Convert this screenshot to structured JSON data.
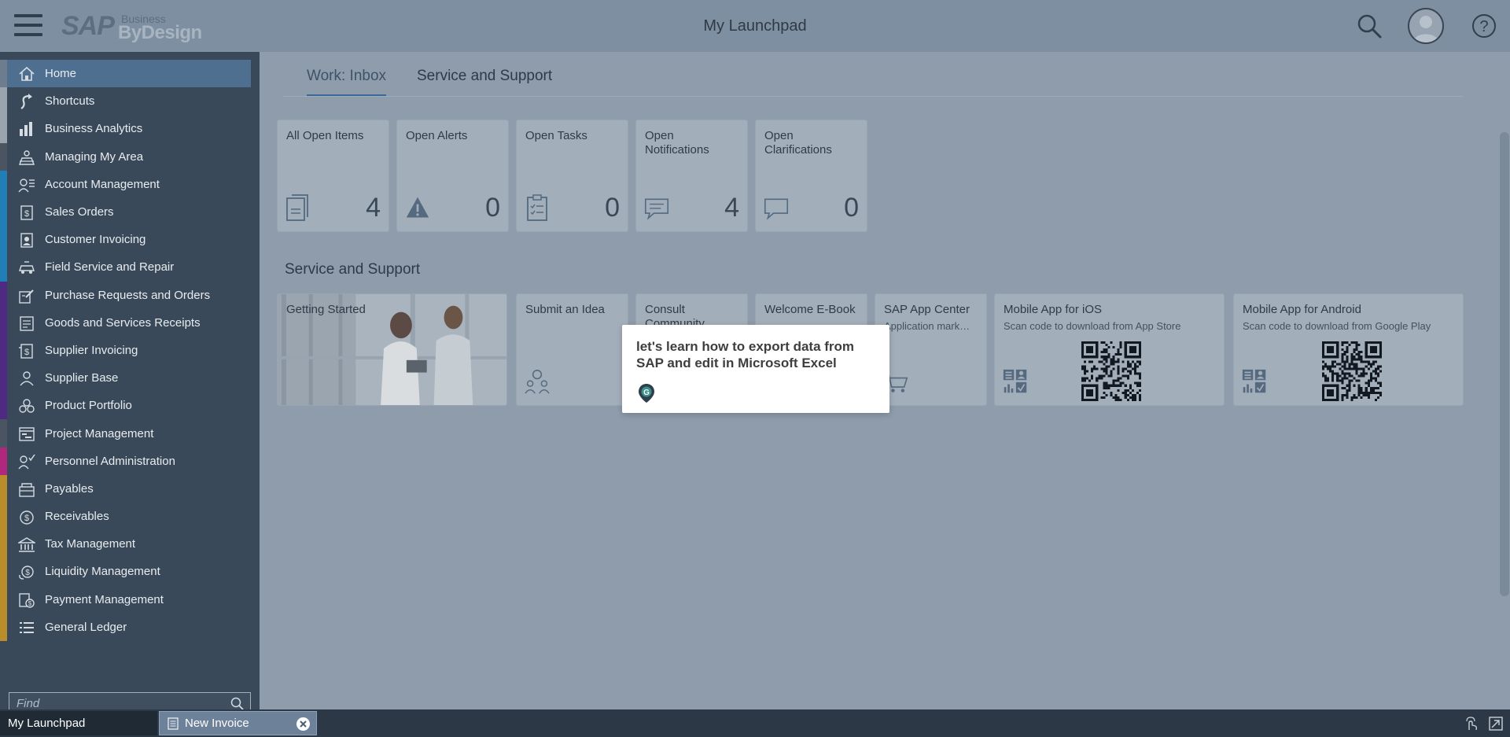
{
  "header": {
    "logo_sap": "SAP",
    "logo_business": "Business",
    "logo_bydesign": "ByDesign",
    "title": "My Launchpad"
  },
  "sidebar": {
    "items": [
      {
        "label": "Home",
        "icon": "home-icon",
        "color": "#6d7d8e"
      },
      {
        "label": "Shortcuts",
        "icon": "shortcut-icon",
        "color": "#9aa4ae"
      },
      {
        "label": "Business Analytics",
        "icon": "analytics-icon",
        "color": "#9aa4ae"
      },
      {
        "label": "Managing My Area",
        "icon": "managing-area-icon",
        "color": "#4b5562"
      },
      {
        "label": "Account Management",
        "icon": "account-management-icon",
        "color": "#1f7fb6"
      },
      {
        "label": "Sales Orders",
        "icon": "sales-orders-icon",
        "color": "#1f7fb6"
      },
      {
        "label": "Customer Invoicing",
        "icon": "customer-invoicing-icon",
        "color": "#1f7fb6"
      },
      {
        "label": "Field Service and Repair",
        "icon": "field-service-icon",
        "color": "#1f7fb6"
      },
      {
        "label": "Purchase Requests and Orders",
        "icon": "purchase-icon",
        "color": "#4e2a82"
      },
      {
        "label": "Goods and Services Receipts",
        "icon": "goods-receipts-icon",
        "color": "#4e2a82"
      },
      {
        "label": "Supplier Invoicing",
        "icon": "supplier-invoicing-icon",
        "color": "#4e2a82"
      },
      {
        "label": "Supplier Base",
        "icon": "supplier-base-icon",
        "color": "#4e2a82"
      },
      {
        "label": "Product Portfolio",
        "icon": "product-portfolio-icon",
        "color": "#4e2a82"
      },
      {
        "label": "Project Management",
        "icon": "project-management-icon",
        "color": "#4b5562"
      },
      {
        "label": "Personnel Administration",
        "icon": "personnel-icon",
        "color": "#b0277e"
      },
      {
        "label": "Payables",
        "icon": "payables-icon",
        "color": "#b88d2a"
      },
      {
        "label": "Receivables",
        "icon": "receivables-icon",
        "color": "#b88d2a"
      },
      {
        "label": "Tax Management",
        "icon": "tax-icon",
        "color": "#b88d2a"
      },
      {
        "label": "Liquidity Management",
        "icon": "liquidity-icon",
        "color": "#b88d2a"
      },
      {
        "label": "Payment Management",
        "icon": "payment-icon",
        "color": "#b88d2a"
      },
      {
        "label": "General Ledger",
        "icon": "ledger-icon",
        "color": "#b88d2a"
      }
    ],
    "find_placeholder": "Find"
  },
  "tabs": [
    {
      "label": "Work: Inbox"
    },
    {
      "label": "Service and Support"
    }
  ],
  "work_tiles": [
    {
      "title": "All Open Items",
      "value": "4",
      "icon": "documents-icon"
    },
    {
      "title": "Open Alerts",
      "value": "0",
      "icon": "alert-icon"
    },
    {
      "title": "Open Tasks",
      "value": "0",
      "icon": "tasks-icon"
    },
    {
      "title": "Open Notifications",
      "value": "4",
      "icon": "notification-icon"
    },
    {
      "title": "Open Clarifications",
      "value": "0",
      "icon": "clarification-icon"
    }
  ],
  "service_section_title": "Service and Support",
  "service_tiles": [
    {
      "title": "Getting Started"
    },
    {
      "title": "Submit an Idea"
    },
    {
      "title": "Consult Community"
    },
    {
      "title": "Welcome E-Book"
    },
    {
      "title": "SAP App Center",
      "subtitle": "Application mark…"
    },
    {
      "title": "Mobile App for iOS",
      "subtitle": "Scan code to download from App Store"
    },
    {
      "title": "Mobile App for Android",
      "subtitle": "Scan code to download from Google Play"
    }
  ],
  "popup": {
    "text": "let's learn how to export data from SAP and edit in Microsoft Excel"
  },
  "taskbar": {
    "tabs": [
      {
        "label": "My Launchpad"
      },
      {
        "label": "New Invoice"
      }
    ]
  }
}
